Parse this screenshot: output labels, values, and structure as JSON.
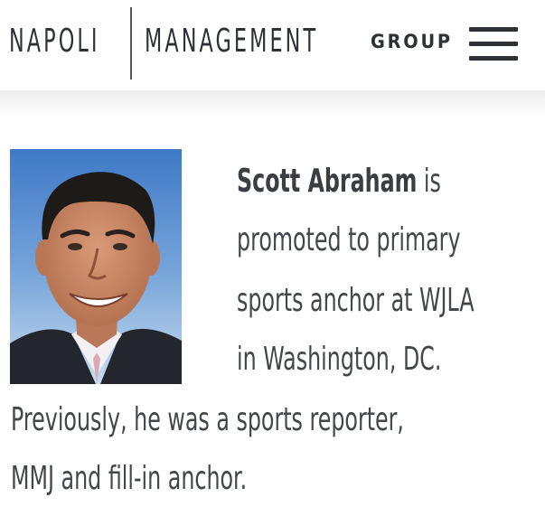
{
  "header": {
    "logo_left": "NAPOLI",
    "logo_right": "MANAGEMENT",
    "logo_suffix": "GROUP",
    "menu_icon": "hamburger-menu-icon"
  },
  "article": {
    "photo_icon": "headshot-photo",
    "name": "Scott Abraham",
    "line1_rest": " is",
    "line2": "promoted to primary",
    "line3": "sports anchor at WJLA",
    "line4": "in Washington, DC.",
    "line5": "Previously, he was a sports reporter,",
    "line6": "MMJ and fill-in anchor."
  },
  "colors": {
    "text": "#43474c",
    "logo": "#2e3136",
    "background": "#ffffff"
  }
}
